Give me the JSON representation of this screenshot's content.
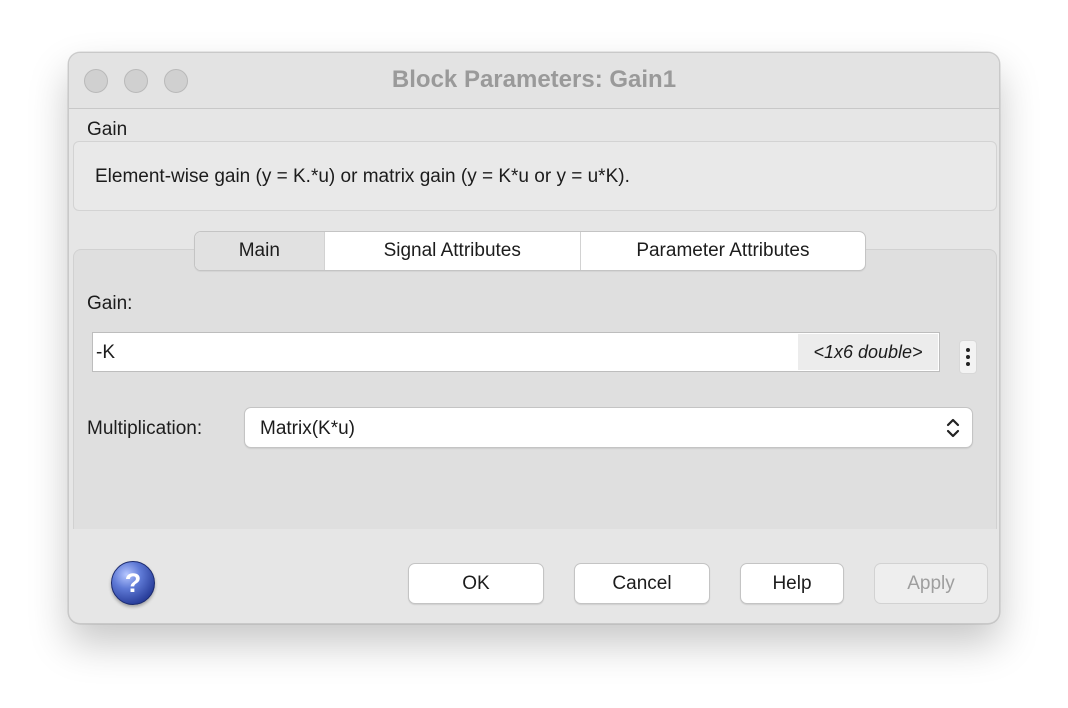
{
  "window": {
    "title": "Block Parameters: Gain1"
  },
  "block": {
    "type_label": "Gain",
    "description": "Element-wise gain (y = K.*u) or matrix gain (y = K*u or y = u*K)."
  },
  "tabs": [
    {
      "label": "Main",
      "active": true
    },
    {
      "label": "Signal Attributes",
      "active": false
    },
    {
      "label": "Parameter Attributes",
      "active": false
    }
  ],
  "main": {
    "gain_label": "Gain:",
    "gain_value": "-K",
    "gain_type_hint": "<1x6 double>",
    "multiplication_label": "Multiplication:",
    "multiplication_value": "Matrix(K*u)"
  },
  "buttons": {
    "ok": "OK",
    "cancel": "Cancel",
    "help": "Help",
    "apply": "Apply",
    "help_icon_glyph": "?"
  },
  "icons": {
    "more_options": "kebab-vertical-icon",
    "select_arrows": "chevron-up-down-icon",
    "help": "question-circle-icon"
  },
  "colors": {
    "window_bg": "#e6e6e6",
    "panel_bg": "#dfdfdf",
    "help_icon": "#2a3f9c",
    "disabled_text": "#9e9e9e"
  }
}
